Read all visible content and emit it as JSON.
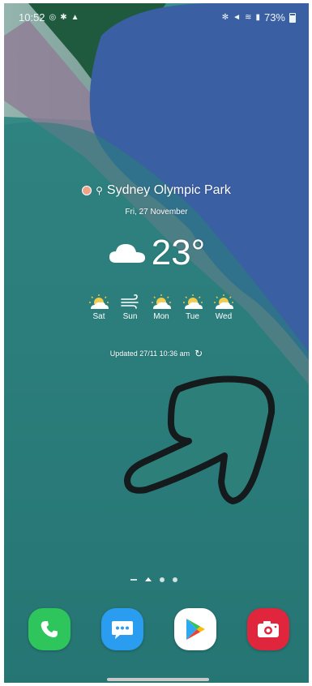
{
  "status_bar": {
    "time": "10:52",
    "battery": "73%"
  },
  "weather": {
    "location": "Sydney Olympic Park",
    "date": "Fri, 27 November",
    "temperature": "23°",
    "forecast": [
      {
        "day": "Sat",
        "icon": "partly-sunny-icon"
      },
      {
        "day": "Sun",
        "icon": "windy-icon"
      },
      {
        "day": "Mon",
        "icon": "partly-sunny-icon"
      },
      {
        "day": "Tue",
        "icon": "partly-sunny-icon"
      },
      {
        "day": "Wed",
        "icon": "partly-sunny-icon"
      }
    ],
    "updated": "Updated 27/11 10:36 am"
  },
  "dock": {
    "apps": [
      "phone-app",
      "messages-app",
      "play-store-app",
      "camera-app"
    ]
  },
  "colors": {
    "phone": "#2ec65c",
    "messages": "#2a9df1",
    "play_store": "#ffffff",
    "camera": "#e0263d",
    "wallpaper_teal": "#2f7f7c",
    "wallpaper_blue": "#3b5fa3"
  }
}
